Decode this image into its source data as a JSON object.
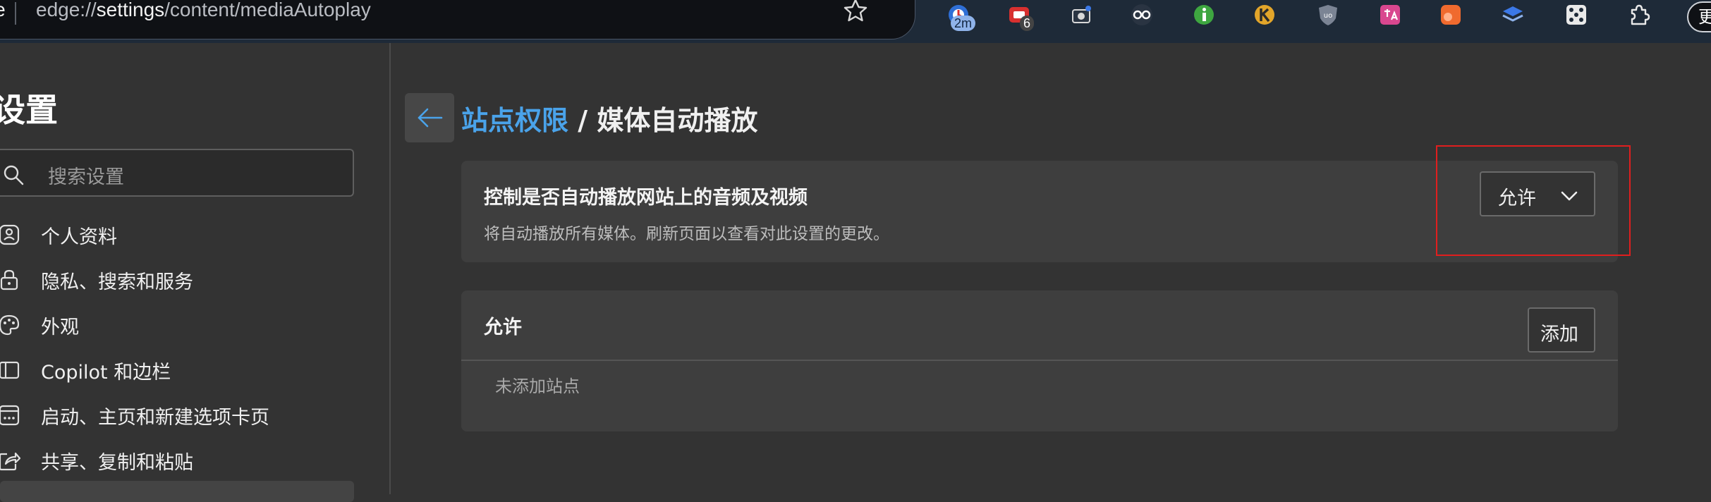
{
  "browser": {
    "address_prefix": "dge",
    "url_scheme": "edge://",
    "url_host": "settings",
    "url_path": "/content/mediaAutoplay",
    "extensions": [
      {
        "name": "timer-extension-icon",
        "badge": "2m",
        "color": "#2f6fd6"
      },
      {
        "name": "red-extension-icon",
        "badge": "6",
        "color": "#d8302f"
      },
      {
        "name": "camera-extension-icon",
        "badge": "",
        "color": "#2a3442"
      },
      {
        "name": "glasses-extension-icon",
        "badge": "",
        "color": "#2a3442"
      },
      {
        "name": "green-info-extension-icon",
        "badge": "",
        "color": "#3ea640"
      },
      {
        "name": "yellow-k-extension-icon",
        "badge": "",
        "color": "#e2a52a"
      },
      {
        "name": "ublock-extension-icon",
        "badge": "",
        "color": "#7b8494"
      },
      {
        "name": "translate-extension-icon",
        "badge": "",
        "color": "#d9478f"
      },
      {
        "name": "orange-extension-icon",
        "badge": "",
        "color": "#f06a2e"
      },
      {
        "name": "layers-extension-icon",
        "badge": "",
        "color": "#3b78e7"
      },
      {
        "name": "dice-extension-icon",
        "badge": "",
        "color": "#e9e9e9"
      },
      {
        "name": "puzzle-extension-icon",
        "badge": "",
        "color": "#e9e9e9"
      }
    ],
    "more_label": "更"
  },
  "sidebar": {
    "title": "设置",
    "search_placeholder": "搜索设置",
    "items": [
      {
        "label": "个人资料",
        "icon": "profile-icon"
      },
      {
        "label": "隐私、搜索和服务",
        "icon": "lock-icon"
      },
      {
        "label": "外观",
        "icon": "palette-icon"
      },
      {
        "label": "Copilot 和边栏",
        "icon": "sidebar-icon"
      },
      {
        "label": "启动、主页和新建选项卡页",
        "icon": "startup-icon"
      },
      {
        "label": "共享、复制和粘贴",
        "icon": "share-icon"
      }
    ]
  },
  "main": {
    "breadcrumb_parent": "站点权限",
    "breadcrumb_separator": " / ",
    "breadcrumb_current": "媒体自动播放",
    "setting": {
      "title": "控制是否自动播放网站上的音频及视频",
      "description": "将自动播放所有媒体。刷新页面以查看对此设置的更改。",
      "dropdown_value": "允许"
    },
    "allow_section": {
      "title": "允许",
      "add_label": "添加",
      "empty_text": "未添加站点"
    }
  },
  "colors": {
    "accent_link": "#4aa3ea",
    "highlight_border": "#e01e1e",
    "background": "#333333",
    "card": "#3e3e3e"
  }
}
